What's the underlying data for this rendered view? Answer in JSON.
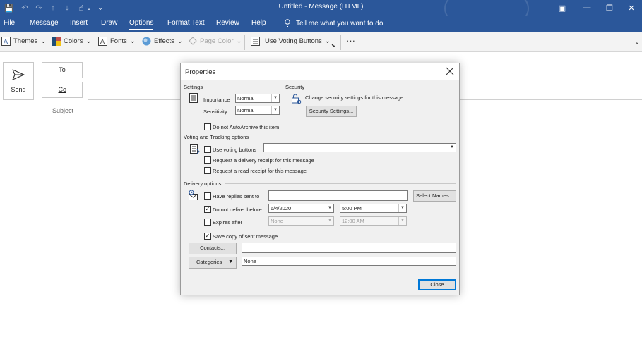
{
  "window": {
    "title": "Untitled  -  Message (HTML)",
    "quick_access": {
      "save": "💾",
      "undo": "↶",
      "redo": "↷",
      "up": "↑",
      "down": "↓",
      "touch": "☝",
      "dropdown": "⌄"
    },
    "controls": {
      "ribbon_display": "▣",
      "minimize": "—",
      "restore": "❐",
      "close": "✕"
    }
  },
  "ribbon": {
    "tabs": [
      "File",
      "Message",
      "Insert",
      "Draw",
      "Options",
      "Format Text",
      "Review",
      "Help"
    ],
    "active_tab": "Options",
    "tell_me": "Tell me what you want to do",
    "toolbar": {
      "themes": "Themes",
      "colors": "Colors",
      "fonts": "Fonts",
      "effects": "Effects",
      "page_color": "Page Color",
      "voting": "Use Voting Buttons",
      "more": "···",
      "collapse": "⌃"
    }
  },
  "compose": {
    "send": "Send",
    "to": "To",
    "cc": "Cc",
    "subject": "Subject"
  },
  "dialog": {
    "title": "Properties",
    "settings": {
      "heading": "Settings",
      "importance_label": "Importance",
      "importance_value": "Normal",
      "sensitivity_label": "Sensitivity",
      "sensitivity_value": "Normal",
      "no_autoarchive": "Do not AutoArchive this item",
      "no_autoarchive_checked": false
    },
    "security": {
      "heading": "Security",
      "text": "Change security settings for this message.",
      "button": "Security Settings..."
    },
    "voting": {
      "heading": "Voting and Tracking options",
      "use_voting": "Use voting buttons",
      "use_voting_checked": false,
      "voting_value": "",
      "delivery_receipt": "Request a delivery receipt for this message",
      "delivery_receipt_checked": false,
      "read_receipt": "Request a read receipt for this message",
      "read_receipt_checked": false
    },
    "delivery": {
      "heading": "Delivery options",
      "replies_to": "Have replies sent to",
      "replies_to_checked": false,
      "replies_to_value": "",
      "select_names": "Select Names...",
      "no_deliver_before": "Do not deliver before",
      "no_deliver_before_checked": true,
      "deliver_date": "6/4/2020",
      "deliver_time": "5:00 PM",
      "expires_after": "Expires after",
      "expires_after_checked": false,
      "expire_date": "None",
      "expire_time": "12:00 AM",
      "save_copy": "Save copy of sent message",
      "save_copy_checked": true
    },
    "contacts_button": "Contacts...",
    "contacts_value": "",
    "categories_button": "Categories",
    "categories_value": "None",
    "close_button": "Close"
  }
}
